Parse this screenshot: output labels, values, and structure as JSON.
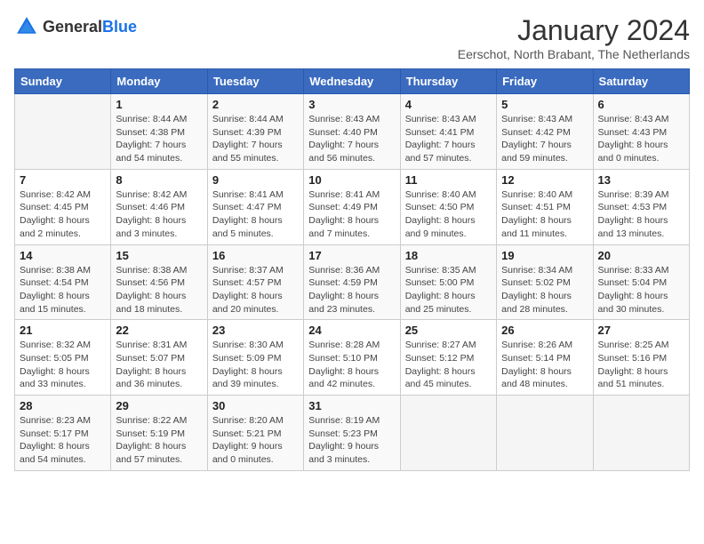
{
  "logo": {
    "general": "General",
    "blue": "Blue"
  },
  "title": "January 2024",
  "subtitle": "Eerschot, North Brabant, The Netherlands",
  "days_of_week": [
    "Sunday",
    "Monday",
    "Tuesday",
    "Wednesday",
    "Thursday",
    "Friday",
    "Saturday"
  ],
  "weeks": [
    [
      {
        "day": "",
        "info": ""
      },
      {
        "day": "1",
        "info": "Sunrise: 8:44 AM\nSunset: 4:38 PM\nDaylight: 7 hours\nand 54 minutes."
      },
      {
        "day": "2",
        "info": "Sunrise: 8:44 AM\nSunset: 4:39 PM\nDaylight: 7 hours\nand 55 minutes."
      },
      {
        "day": "3",
        "info": "Sunrise: 8:43 AM\nSunset: 4:40 PM\nDaylight: 7 hours\nand 56 minutes."
      },
      {
        "day": "4",
        "info": "Sunrise: 8:43 AM\nSunset: 4:41 PM\nDaylight: 7 hours\nand 57 minutes."
      },
      {
        "day": "5",
        "info": "Sunrise: 8:43 AM\nSunset: 4:42 PM\nDaylight: 7 hours\nand 59 minutes."
      },
      {
        "day": "6",
        "info": "Sunrise: 8:43 AM\nSunset: 4:43 PM\nDaylight: 8 hours\nand 0 minutes."
      }
    ],
    [
      {
        "day": "7",
        "info": "Sunrise: 8:42 AM\nSunset: 4:45 PM\nDaylight: 8 hours\nand 2 minutes."
      },
      {
        "day": "8",
        "info": "Sunrise: 8:42 AM\nSunset: 4:46 PM\nDaylight: 8 hours\nand 3 minutes."
      },
      {
        "day": "9",
        "info": "Sunrise: 8:41 AM\nSunset: 4:47 PM\nDaylight: 8 hours\nand 5 minutes."
      },
      {
        "day": "10",
        "info": "Sunrise: 8:41 AM\nSunset: 4:49 PM\nDaylight: 8 hours\nand 7 minutes."
      },
      {
        "day": "11",
        "info": "Sunrise: 8:40 AM\nSunset: 4:50 PM\nDaylight: 8 hours\nand 9 minutes."
      },
      {
        "day": "12",
        "info": "Sunrise: 8:40 AM\nSunset: 4:51 PM\nDaylight: 8 hours\nand 11 minutes."
      },
      {
        "day": "13",
        "info": "Sunrise: 8:39 AM\nSunset: 4:53 PM\nDaylight: 8 hours\nand 13 minutes."
      }
    ],
    [
      {
        "day": "14",
        "info": "Sunrise: 8:38 AM\nSunset: 4:54 PM\nDaylight: 8 hours\nand 15 minutes."
      },
      {
        "day": "15",
        "info": "Sunrise: 8:38 AM\nSunset: 4:56 PM\nDaylight: 8 hours\nand 18 minutes."
      },
      {
        "day": "16",
        "info": "Sunrise: 8:37 AM\nSunset: 4:57 PM\nDaylight: 8 hours\nand 20 minutes."
      },
      {
        "day": "17",
        "info": "Sunrise: 8:36 AM\nSunset: 4:59 PM\nDaylight: 8 hours\nand 23 minutes."
      },
      {
        "day": "18",
        "info": "Sunrise: 8:35 AM\nSunset: 5:00 PM\nDaylight: 8 hours\nand 25 minutes."
      },
      {
        "day": "19",
        "info": "Sunrise: 8:34 AM\nSunset: 5:02 PM\nDaylight: 8 hours\nand 28 minutes."
      },
      {
        "day": "20",
        "info": "Sunrise: 8:33 AM\nSunset: 5:04 PM\nDaylight: 8 hours\nand 30 minutes."
      }
    ],
    [
      {
        "day": "21",
        "info": "Sunrise: 8:32 AM\nSunset: 5:05 PM\nDaylight: 8 hours\nand 33 minutes."
      },
      {
        "day": "22",
        "info": "Sunrise: 8:31 AM\nSunset: 5:07 PM\nDaylight: 8 hours\nand 36 minutes."
      },
      {
        "day": "23",
        "info": "Sunrise: 8:30 AM\nSunset: 5:09 PM\nDaylight: 8 hours\nand 39 minutes."
      },
      {
        "day": "24",
        "info": "Sunrise: 8:28 AM\nSunset: 5:10 PM\nDaylight: 8 hours\nand 42 minutes."
      },
      {
        "day": "25",
        "info": "Sunrise: 8:27 AM\nSunset: 5:12 PM\nDaylight: 8 hours\nand 45 minutes."
      },
      {
        "day": "26",
        "info": "Sunrise: 8:26 AM\nSunset: 5:14 PM\nDaylight: 8 hours\nand 48 minutes."
      },
      {
        "day": "27",
        "info": "Sunrise: 8:25 AM\nSunset: 5:16 PM\nDaylight: 8 hours\nand 51 minutes."
      }
    ],
    [
      {
        "day": "28",
        "info": "Sunrise: 8:23 AM\nSunset: 5:17 PM\nDaylight: 8 hours\nand 54 minutes."
      },
      {
        "day": "29",
        "info": "Sunrise: 8:22 AM\nSunset: 5:19 PM\nDaylight: 8 hours\nand 57 minutes."
      },
      {
        "day": "30",
        "info": "Sunrise: 8:20 AM\nSunset: 5:21 PM\nDaylight: 9 hours\nand 0 minutes."
      },
      {
        "day": "31",
        "info": "Sunrise: 8:19 AM\nSunset: 5:23 PM\nDaylight: 9 hours\nand 3 minutes."
      },
      {
        "day": "",
        "info": ""
      },
      {
        "day": "",
        "info": ""
      },
      {
        "day": "",
        "info": ""
      }
    ]
  ]
}
